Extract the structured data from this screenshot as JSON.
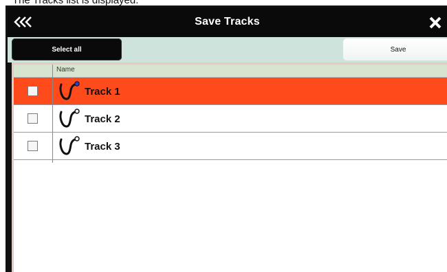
{
  "caption": "The Tracks list is displayed.",
  "dialog": {
    "title": "Save Tracks",
    "back_icon": "triple-chevron-left-icon",
    "close_icon": "close-icon"
  },
  "toolbar": {
    "select_all_label": "Select all",
    "save_label": "Save"
  },
  "list": {
    "column_name_header": "Name",
    "rows": [
      {
        "name": "Track 1",
        "selected": true,
        "checked": false
      },
      {
        "name": "Track 2",
        "selected": false,
        "checked": false
      },
      {
        "name": "Track 3",
        "selected": false,
        "checked": false
      }
    ]
  },
  "colors": {
    "selected_row": "#ff4a1c",
    "toolbar_bg": "#cfe3dd",
    "header_bg": "#d7e4cf",
    "list_border": "#e8c9bd"
  }
}
